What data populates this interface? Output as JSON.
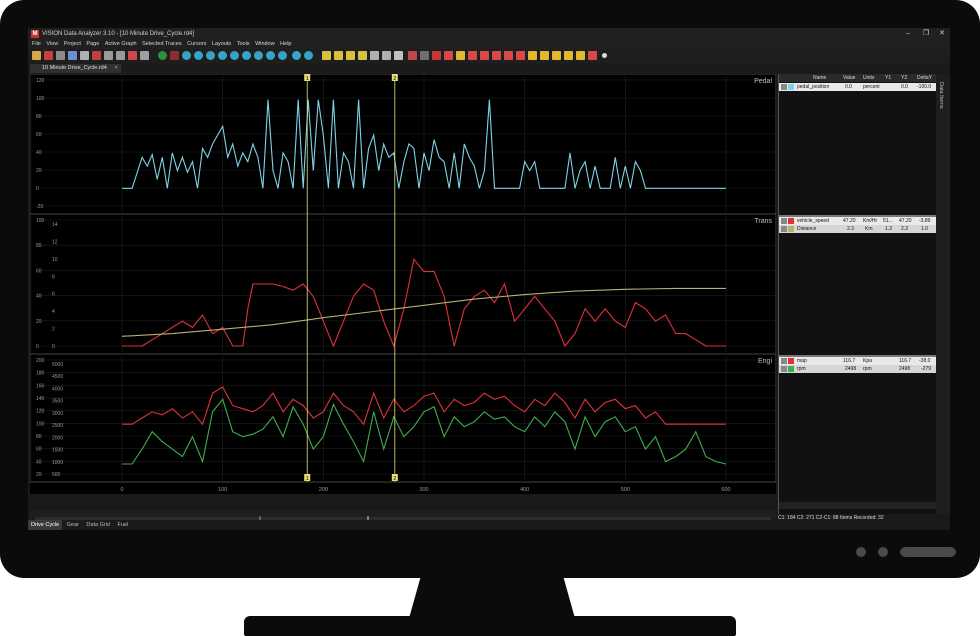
{
  "app": {
    "title": "VISION Data Analyzer 3.10 - [10 Minute Drive_Cycle.rd4]",
    "icon_letter": "M"
  },
  "window_controls": {
    "minimize": "–",
    "maximize": "❐",
    "close": "✕"
  },
  "menu": [
    "File",
    "View",
    "Project",
    "Page",
    "Active Graph",
    "Selected Traces",
    "Cursors",
    "Layouts",
    "Tools",
    "Window",
    "Help"
  ],
  "document_tab": {
    "label": "10 Minute Drive_Cycle.rd4",
    "close": "×"
  },
  "side_tab_label": "Data Items",
  "cursor_labels": {
    "c1": "1",
    "c2": "2"
  },
  "colors": {
    "pedal": "#7fd3e6",
    "speed": "#e0303a",
    "distance": "#b8b070",
    "map": "#e0303a",
    "rpm": "#3fae4e",
    "cursor": "#e6e07a"
  },
  "graphs": [
    {
      "title": "Pedal",
      "left_ticks": [
        "120",
        "100",
        "80",
        "60",
        "40",
        "20",
        "0",
        "-20"
      ]
    },
    {
      "title": "Trans",
      "left_ticks_outer": [
        "100",
        "80",
        "60",
        "40",
        "20",
        "0"
      ],
      "left_ticks_inner": [
        "14",
        "12",
        "10",
        "8",
        "6",
        "4",
        "2",
        "0"
      ]
    },
    {
      "title": "Engi",
      "left_ticks_outer": [
        "200",
        "180",
        "160",
        "140",
        "120",
        "100",
        "80",
        "60",
        "40",
        "20"
      ],
      "left_ticks_inner": [
        "5000",
        "4500",
        "4000",
        "3500",
        "3000",
        "2500",
        "2000",
        "1500",
        "1000",
        "500"
      ]
    }
  ],
  "x_axis_ticks": [
    "0",
    "100",
    "200",
    "300",
    "400",
    "500",
    "600"
  ],
  "data_panel": {
    "headers": [
      "Name",
      "Value",
      "Units",
      "Y1",
      "Y2",
      "DeltaY"
    ],
    "group1": [
      {
        "name": "pedal_position",
        "value": "0.0",
        "units": "percent",
        "y1": "0.0",
        "y2": "0.0",
        "delta": "-100.0"
      }
    ],
    "group2": [
      {
        "name": "vehicle_speed",
        "value": "47.20",
        "units": "Km/Hr",
        "y1": "51...",
        "y2": "47.20",
        "delta": "-3.89"
      },
      {
        "name": "Distance",
        "value": "2.3",
        "units": "Km",
        "y1": "1.3",
        "y2": "2.3",
        "delta": "1.0"
      }
    ],
    "group3": [
      {
        "name": "map",
        "value": "116.7",
        "units": "Kpa",
        "y1": "",
        "y2": "116.7",
        "delta": "-38.0"
      },
      {
        "name": "rpm",
        "value": "2498",
        "units": "rpm",
        "y1": "",
        "y2": "2498",
        "delta": "-279"
      }
    ]
  },
  "status": "C1: 184   C2: 271   C2-C1: 88   Items Recorded: 32",
  "bottom_tabs": [
    "Drive Cycle",
    "Gear",
    "Data Grid",
    "Fuel"
  ],
  "chart_data": {
    "type": "line",
    "xlim": [
      0,
      600
    ],
    "cursors": {
      "c1": 184,
      "c2": 271
    },
    "series": [
      {
        "name": "pedal_position",
        "panel": 0,
        "ylim": [
          -20,
          120
        ],
        "x": [
          0,
          10,
          20,
          25,
          30,
          35,
          40,
          45,
          50,
          55,
          60,
          65,
          70,
          75,
          80,
          85,
          90,
          95,
          100,
          105,
          110,
          115,
          120,
          125,
          130,
          135,
          140,
          145,
          150,
          155,
          160,
          165,
          170,
          175,
          180,
          185,
          190,
          195,
          200,
          205,
          210,
          215,
          220,
          225,
          230,
          235,
          240,
          245,
          250,
          255,
          260,
          265,
          270,
          275,
          280,
          285,
          290,
          295,
          300,
          305,
          310,
          315,
          320,
          325,
          330,
          335,
          340,
          345,
          350,
          355,
          360,
          365,
          370,
          375,
          380,
          385,
          390,
          395,
          400,
          405,
          410,
          415,
          420,
          425,
          430,
          435,
          440,
          445,
          450,
          455,
          460,
          465,
          470,
          475,
          480,
          485,
          490,
          495,
          500,
          505,
          510,
          515,
          520,
          525,
          530,
          535,
          540,
          545,
          550,
          555,
          560,
          565,
          570,
          575,
          580,
          585,
          590,
          595,
          600
        ],
        "y": [
          0,
          0,
          35,
          25,
          38,
          10,
          35,
          0,
          40,
          20,
          35,
          18,
          30,
          0,
          45,
          35,
          50,
          60,
          70,
          35,
          50,
          25,
          40,
          30,
          50,
          35,
          0,
          100,
          20,
          0,
          40,
          30,
          0,
          100,
          0,
          100,
          20,
          100,
          60,
          0,
          100,
          0,
          40,
          30,
          0,
          100,
          0,
          45,
          60,
          20,
          50,
          35,
          40,
          0,
          30,
          50,
          45,
          0,
          40,
          20,
          55,
          35,
          30,
          0,
          40,
          0,
          50,
          35,
          25,
          0,
          20,
          100,
          0,
          0,
          0,
          0,
          0,
          0,
          30,
          20,
          30,
          0,
          0,
          0,
          0,
          0,
          0,
          40,
          0,
          20,
          30,
          0,
          25,
          0,
          0,
          0,
          35,
          0,
          25,
          0,
          30,
          20,
          0,
          0,
          0,
          0,
          0,
          0,
          0,
          0,
          0,
          0,
          0,
          0,
          0,
          0,
          0,
          0,
          0
        ]
      },
      {
        "name": "vehicle_speed",
        "panel": 1,
        "ylim": [
          0,
          100
        ],
        "x": [
          0,
          10,
          20,
          30,
          40,
          50,
          60,
          70,
          80,
          90,
          100,
          110,
          120,
          125,
          130,
          140,
          150,
          160,
          170,
          180,
          190,
          200,
          210,
          220,
          230,
          240,
          250,
          260,
          270,
          280,
          290,
          300,
          310,
          320,
          330,
          340,
          350,
          360,
          370,
          380,
          390,
          400,
          410,
          420,
          430,
          440,
          450,
          460,
          470,
          480,
          490,
          500,
          510,
          520,
          530,
          540,
          550,
          560,
          570,
          580,
          590,
          600
        ],
        "y": [
          0,
          0,
          0,
          5,
          10,
          15,
          20,
          15,
          25,
          10,
          15,
          0,
          0,
          30,
          50,
          50,
          50,
          48,
          45,
          50,
          40,
          20,
          0,
          20,
          40,
          50,
          45,
          20,
          0,
          30,
          70,
          60,
          60,
          40,
          0,
          30,
          40,
          45,
          35,
          50,
          20,
          30,
          40,
          30,
          20,
          0,
          10,
          30,
          20,
          30,
          20,
          15,
          35,
          30,
          20,
          25,
          10,
          10,
          5,
          0,
          0,
          0
        ]
      },
      {
        "name": "Distance",
        "panel": 1,
        "ylim": [
          0,
          14
        ],
        "x": [
          0,
          50,
          100,
          150,
          200,
          250,
          300,
          350,
          400,
          450,
          500,
          550,
          600
        ],
        "y": [
          1.1,
          1.4,
          1.9,
          2.4,
          3.2,
          3.9,
          4.6,
          5.3,
          5.8,
          6.2,
          6.4,
          6.5,
          6.5
        ]
      },
      {
        "name": "map",
        "panel": 2,
        "ylim": [
          20,
          200
        ],
        "x": [
          0,
          10,
          20,
          30,
          40,
          50,
          60,
          70,
          80,
          90,
          100,
          110,
          120,
          130,
          140,
          150,
          160,
          170,
          180,
          190,
          200,
          210,
          220,
          230,
          240,
          250,
          260,
          270,
          280,
          290,
          300,
          310,
          320,
          330,
          340,
          350,
          360,
          370,
          380,
          390,
          400,
          410,
          420,
          430,
          440,
          450,
          460,
          470,
          480,
          490,
          500,
          510,
          520,
          530,
          540,
          550,
          560,
          570,
          580,
          590,
          600
        ],
        "y": [
          100,
          100,
          110,
          120,
          115,
          125,
          110,
          120,
          100,
          150,
          160,
          130,
          125,
          120,
          130,
          150,
          120,
          140,
          130,
          110,
          120,
          150,
          130,
          120,
          100,
          150,
          110,
          140,
          120,
          130,
          145,
          150,
          120,
          140,
          130,
          135,
          150,
          140,
          145,
          130,
          120,
          140,
          130,
          150,
          135,
          110,
          140,
          120,
          135,
          140,
          125,
          130,
          110,
          120,
          100,
          100,
          100,
          100,
          100,
          100,
          100
        ]
      },
      {
        "name": "rpm",
        "panel": 2,
        "ylim": [
          500,
          5000
        ],
        "x": [
          0,
          10,
          20,
          30,
          40,
          50,
          60,
          70,
          80,
          90,
          100,
          110,
          120,
          130,
          140,
          150,
          160,
          170,
          180,
          190,
          200,
          210,
          220,
          230,
          240,
          250,
          260,
          270,
          280,
          290,
          300,
          310,
          320,
          330,
          340,
          350,
          360,
          370,
          380,
          390,
          400,
          410,
          420,
          430,
          440,
          450,
          460,
          470,
          480,
          490,
          500,
          510,
          520,
          530,
          540,
          550,
          560,
          570,
          580,
          590,
          600
        ],
        "y": [
          900,
          900,
          1500,
          2200,
          1800,
          1500,
          1200,
          2000,
          1000,
          3000,
          3500,
          2200,
          2000,
          2100,
          2300,
          2800,
          2000,
          3200,
          2500,
          1500,
          2000,
          3300,
          2500,
          1800,
          1000,
          3000,
          1500,
          2800,
          2000,
          2400,
          3000,
          3200,
          2000,
          2800,
          2400,
          2600,
          3000,
          2700,
          2800,
          2400,
          2200,
          2800,
          2400,
          3000,
          2600,
          1500,
          2800,
          2000,
          2600,
          2800,
          2200,
          2400,
          1500,
          2000,
          1000,
          1200,
          1500,
          2200,
          1200,
          1000,
          900
        ]
      }
    ]
  }
}
